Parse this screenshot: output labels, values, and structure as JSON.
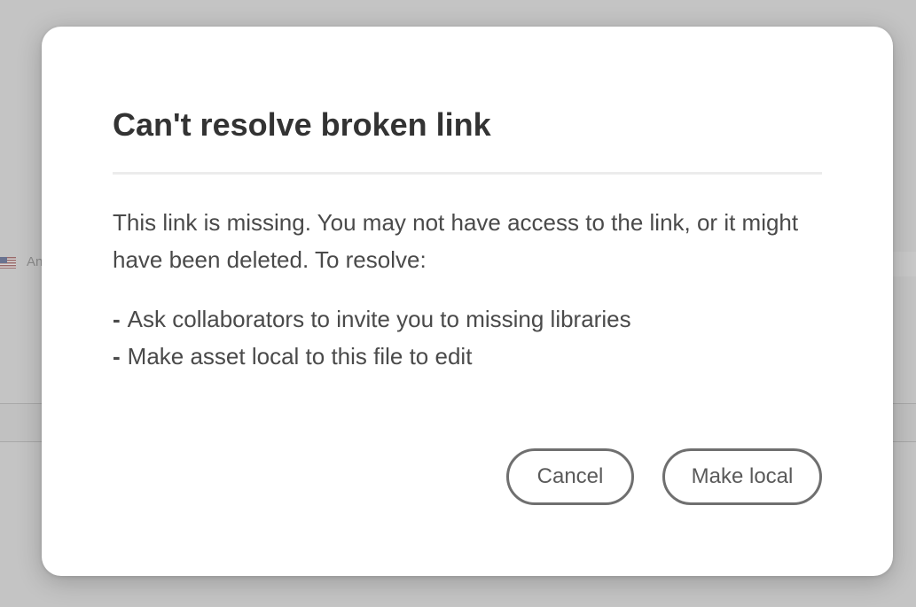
{
  "background": {
    "language_label": "An"
  },
  "dialog": {
    "title": "Can't resolve broken link",
    "message": "This link is missing. You may not have access to the link, or it might have been deleted. To resolve:",
    "steps": [
      "Ask collaborators to invite you to missing libraries",
      "Make asset local to this file to edit"
    ],
    "bullet": "-",
    "cancel_label": "Cancel",
    "confirm_label": "Make local"
  },
  "colors": {
    "overlay": "#c4c4c4",
    "dialog_bg": "#ffffff",
    "title_text": "#333333",
    "body_text": "#4a4a4a",
    "button_border": "#6f6f6f"
  }
}
